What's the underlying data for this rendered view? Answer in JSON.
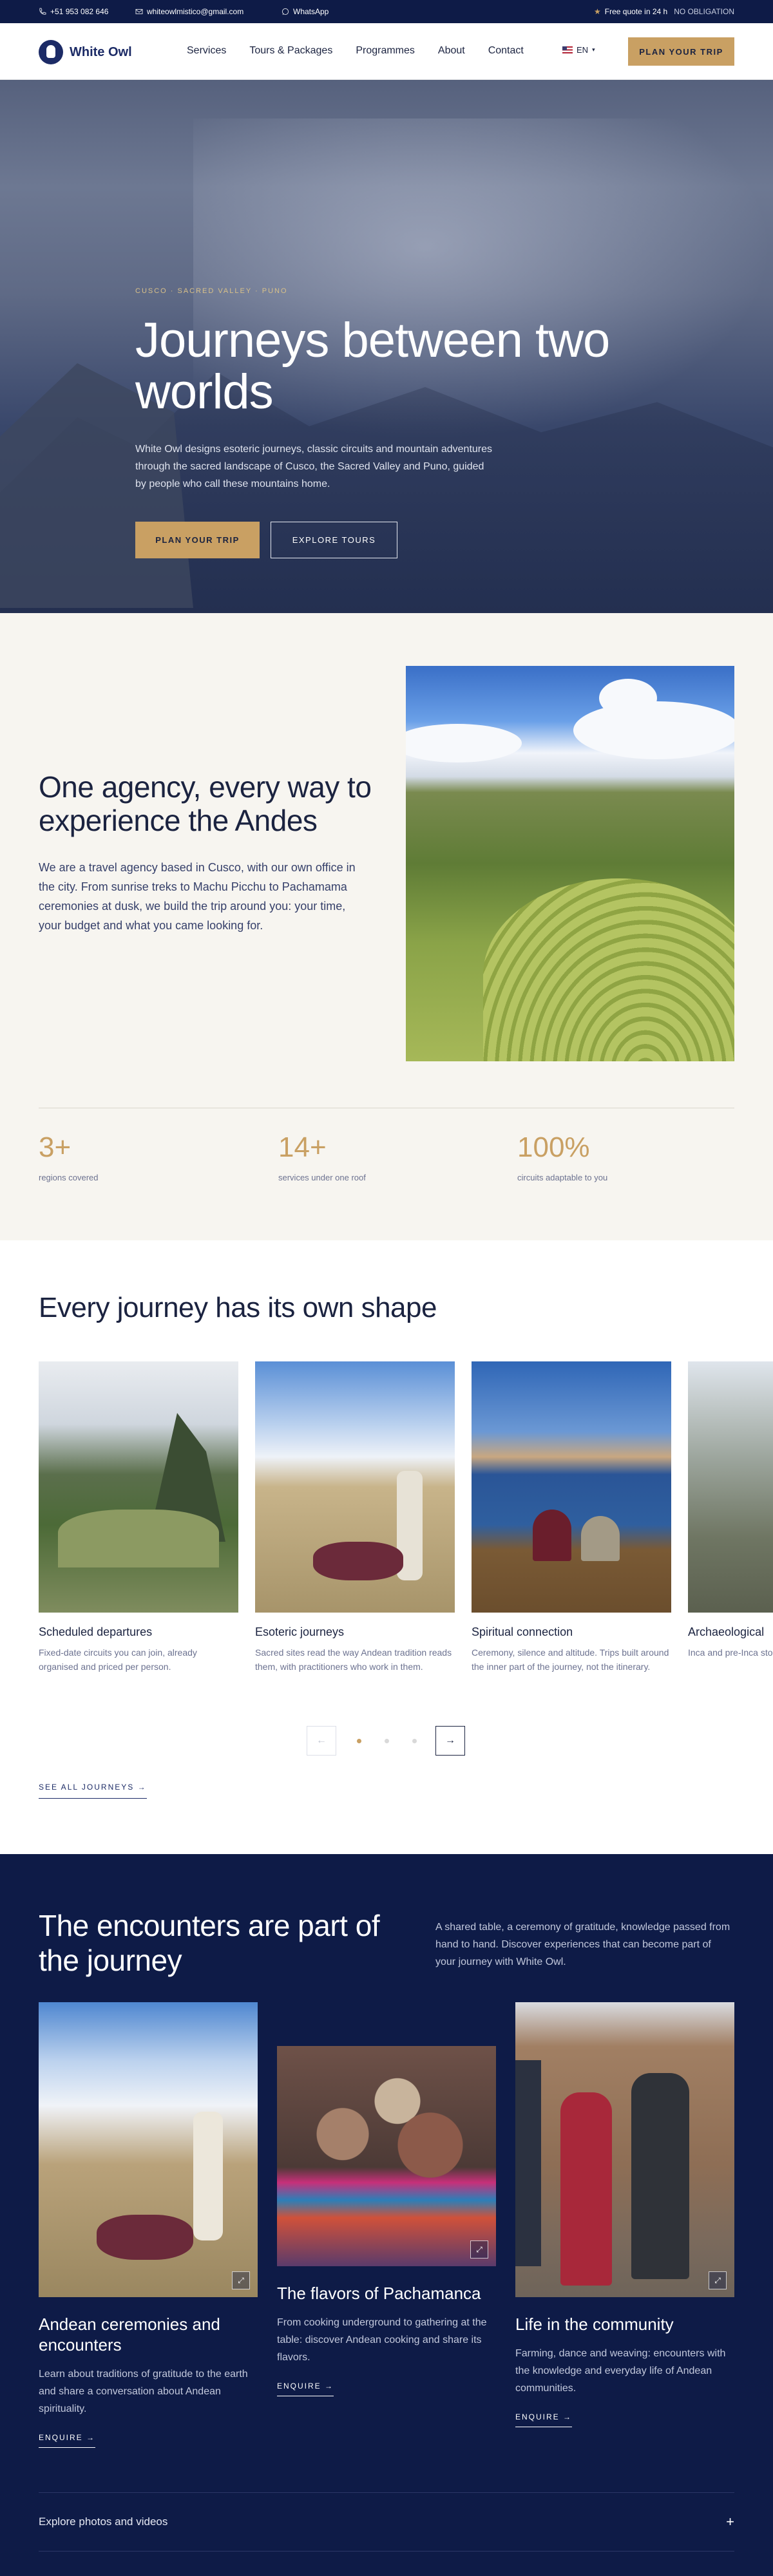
{
  "topbar": {
    "phone": "+51 953 082 646",
    "email": "whiteowlmistico@gmail.com",
    "whatsapp": "WhatsApp",
    "quote": "Free quote in 24 h",
    "no_obligation": "NO OBLIGATION"
  },
  "header": {
    "logo": "White Owl",
    "nav": [
      "Services",
      "Tours & Packages",
      "Programmes",
      "About",
      "Contact"
    ],
    "lang": "EN",
    "cta": "PLAN YOUR TRIP"
  },
  "hero": {
    "kicker": "CUSCO · SACRED VALLEY · PUNO",
    "title": "Journeys between two worlds",
    "lead": "White Owl designs esoteric journeys, classic circuits and mountain adventures through the sacred landscape of Cusco, the Sacred Valley and Puno, guided by people who call these mountains home.",
    "primary": "PLAN YOUR TRIP",
    "secondary": "EXPLORE TOURS"
  },
  "intro": {
    "title": "One agency, every way to experience the Andes",
    "body": "We are a travel agency based in Cusco, with our own office in the city. From sunrise treks to Machu Picchu to Pachamama ceremonies at dusk, we build the trip around you: your time, your budget and what you came looking for.",
    "stats": [
      {
        "num": "3+",
        "label": "regions covered"
      },
      {
        "num": "14+",
        "label": "services under one roof"
      },
      {
        "num": "100%",
        "label": "circuits adaptable to you"
      }
    ]
  },
  "journeys": {
    "title": "Every journey has its own shape",
    "cards": [
      {
        "title": "Scheduled departures",
        "text": "Fixed-date circuits you can join, already organised and priced per person."
      },
      {
        "title": "Esoteric journeys",
        "text": "Sacred sites read the way Andean tradition reads them, with practitioners who work in them."
      },
      {
        "title": "Spiritual connection",
        "text": "Ceremony, silence and altitude. Trips built around the inner part of the journey, not the itinerary."
      },
      {
        "title": "Archaeological",
        "text": "Inca and pre-Inca stonework, with gu"
      }
    ],
    "prev": "←",
    "next": "→",
    "see_all": "SEE ALL JOURNEYS →"
  },
  "encounters": {
    "title": "The encounters are part of the journey",
    "side": "A shared table, a ceremony of gratitude, knowledge passed from hand to hand. Discover experiences that can become part of your journey with White Owl.",
    "cards": [
      {
        "title": "Andean ceremonies and encounters",
        "text": "Learn about traditions of gratitude to the earth and share a conversation about Andean spirituality.",
        "link": "ENQUIRE →"
      },
      {
        "title": "The flavors of Pachamanca",
        "text": "From cooking underground to gathering at the table: discover Andean cooking and share its flavors.",
        "link": "ENQUIRE →"
      },
      {
        "title": "Life in the community",
        "text": "Farming, dance and weaving: encounters with the knowledge and everyday life of Andean communities.",
        "link": "ENQUIRE →"
      }
    ],
    "accordion": "Explore photos and videos",
    "accordion_icon": "+"
  },
  "colors": {
    "navy": "#0e1b47",
    "gold": "#c9a063",
    "cream": "#f7f5f0"
  }
}
